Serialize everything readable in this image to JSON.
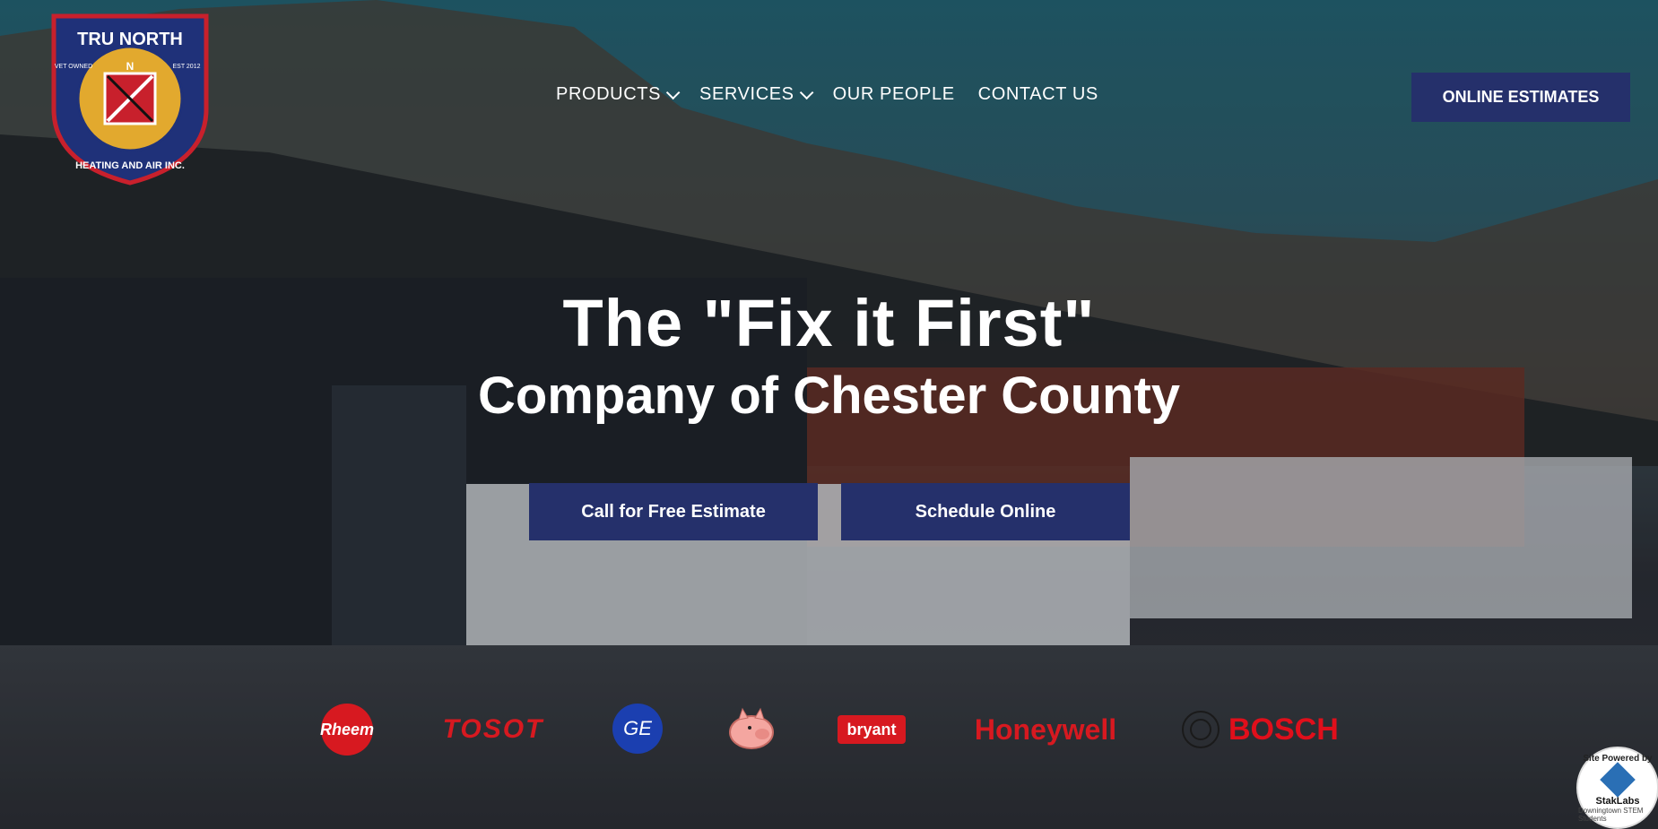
{
  "logo": {
    "line1": "TRU NORTH",
    "line2": "HEATING AND AIR INC.",
    "vet_owned": "VET OWNED",
    "est": "EST 2012",
    "compass": "N"
  },
  "nav": {
    "items": [
      {
        "label": "PRODUCTS",
        "has_dropdown": true
      },
      {
        "label": "SERVICES",
        "has_dropdown": true
      },
      {
        "label": "OUR PEOPLE",
        "has_dropdown": false
      },
      {
        "label": "CONTACT US",
        "has_dropdown": false
      }
    ],
    "cta_label": "ONLINE ESTIMATES"
  },
  "hero": {
    "headline": "The \"Fix it First\"",
    "subheadline": "Company of Chester County",
    "call_button": "Call for Free Estimate",
    "schedule_button": "Schedule Online"
  },
  "brands": {
    "rheem": "Rheem",
    "tosot": "TOSOT",
    "ge": "GE",
    "bryant": "bryant",
    "honeywell": "Honeywell",
    "bosch": "BOSCH"
  },
  "badge": {
    "top": "Site Powered by",
    "name": "StakLabs",
    "bottom": "Downingtown STEM Students"
  },
  "colors": {
    "brand_navy": "#25306b",
    "brand_red": "#d71920",
    "text_white": "#ffffff"
  }
}
